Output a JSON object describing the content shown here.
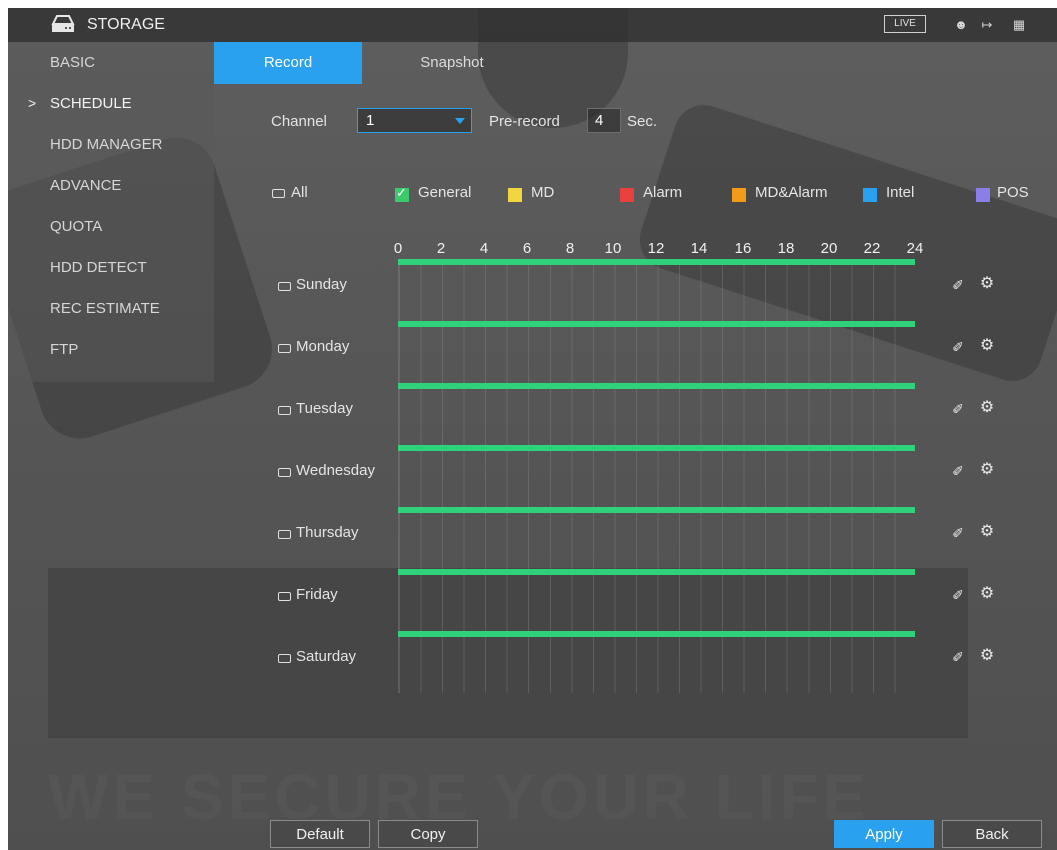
{
  "app": {
    "title": "STORAGE",
    "live_label": "LIVE",
    "watermark": "WE SECURE YOUR LIFE"
  },
  "header_icons": [
    "user-icon",
    "logout-icon",
    "grid-menu-icon"
  ],
  "sidebar": {
    "items": [
      {
        "label": "BASIC"
      },
      {
        "label": "SCHEDULE"
      },
      {
        "label": "HDD MANAGER"
      },
      {
        "label": "ADVANCE"
      },
      {
        "label": "QUOTA"
      },
      {
        "label": "HDD DETECT"
      },
      {
        "label": "REC ESTIMATE"
      },
      {
        "label": "FTP"
      }
    ],
    "active_marker": ">"
  },
  "tabs": [
    {
      "label": "Record"
    },
    {
      "label": "Snapshot"
    }
  ],
  "controls": {
    "channel_label": "Channel",
    "channel_value": "1",
    "prerecord_label": "Pre-record",
    "prerecord_value": "4",
    "prerecord_unit": "Sec."
  },
  "legend": {
    "all_label": "All",
    "items": [
      {
        "label": "General",
        "color": "#3ec96d",
        "checked": true
      },
      {
        "label": "MD",
        "color": "#f2d640"
      },
      {
        "label": "Alarm",
        "color": "#e8403f"
      },
      {
        "label": "MD&Alarm",
        "color": "#f29a1a"
      },
      {
        "label": "Intel",
        "color": "#2aa1ee"
      },
      {
        "label": "POS",
        "color": "#8a7fe8"
      }
    ]
  },
  "timeline": {
    "ticks": [
      "0",
      "2",
      "4",
      "6",
      "8",
      "10",
      "12",
      "14",
      "16",
      "18",
      "20",
      "22",
      "24"
    ],
    "bar_color": "#2fd17a",
    "days": [
      {
        "label": "Sunday",
        "coverage": [
          0,
          24
        ]
      },
      {
        "label": "Monday",
        "coverage": [
          0,
          24
        ]
      },
      {
        "label": "Tuesday",
        "coverage": [
          0,
          24
        ]
      },
      {
        "label": "Wednesday",
        "coverage": [
          0,
          24
        ]
      },
      {
        "label": "Thursday",
        "coverage": [
          0,
          24
        ]
      },
      {
        "label": "Friday",
        "coverage": [
          0,
          24
        ]
      },
      {
        "label": "Saturday",
        "coverage": [
          0,
          24
        ]
      }
    ]
  },
  "buttons": {
    "default": "Default",
    "copy": "Copy",
    "apply": "Apply",
    "back": "Back"
  }
}
